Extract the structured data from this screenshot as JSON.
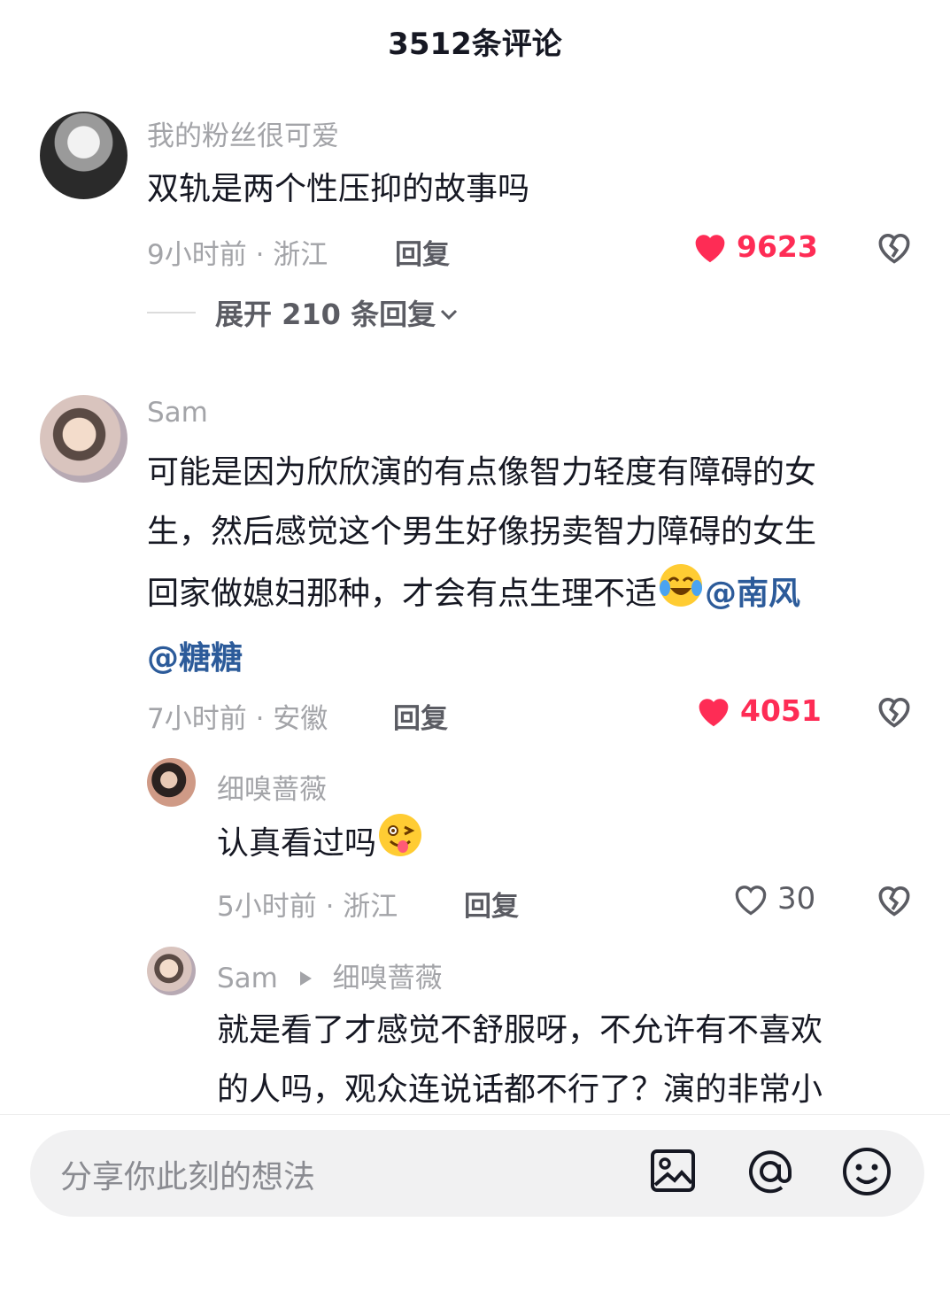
{
  "header": {
    "title": "3512条评论"
  },
  "comments": [
    {
      "username": "我的粉丝很可爱",
      "text": "双轨是两个性压抑的故事吗",
      "meta": "9小时前 · 浙江",
      "reply_label": "回复",
      "likes": "9623",
      "liked": true,
      "expand_label": "展开 210 条回复"
    },
    {
      "username": "Sam",
      "text_parts": [
        "可能是因为欣欣演的有点像智力轻度有障碍的女",
        "生，然后感觉这个男生好像拐卖智力障碍的女生",
        "回家做媳妇那种，才会有点生理不适"
      ],
      "emoji": "crying-laughing-emoji",
      "mentions": [
        "@南风",
        "@糖糖"
      ],
      "meta": "7小时前 · 安徽",
      "reply_label": "回复",
      "likes": "4051",
      "liked": true
    }
  ],
  "replies": [
    {
      "username": "细嗅蔷薇",
      "text": "认真看过吗",
      "emoji": "winking-tongue-emoji",
      "meta": "5小时前 · 浙江",
      "reply_label": "回复",
      "likes": "30",
      "liked": false
    },
    {
      "username": "Sam",
      "reply_to": "细嗅蔷薇",
      "text_lines": [
        "就是看了才感觉不舒服呀，不允许有不喜欢",
        "的人吗，观众连说话都不行了？演的非常小"
      ]
    }
  ],
  "composer": {
    "placeholder": "分享你此刻的想法",
    "icons": [
      "image-icon",
      "at-icon",
      "emoji-icon"
    ]
  },
  "colors": {
    "like": "#fe2c55",
    "mention": "#2c5b9a",
    "meta": "#a3a4a8"
  }
}
